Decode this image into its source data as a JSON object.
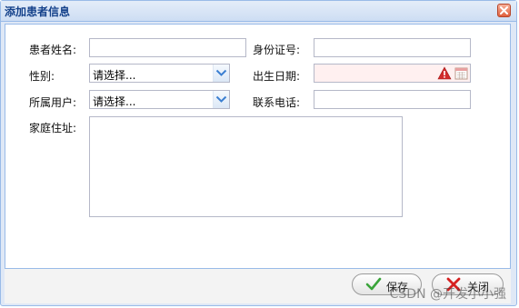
{
  "dialog": {
    "title": "添加患者信息",
    "close_icon": "close-icon"
  },
  "form": {
    "patient_name": {
      "label": "患者姓名:",
      "value": ""
    },
    "id_number": {
      "label": "身份证号:",
      "value": ""
    },
    "gender": {
      "label": "性别:",
      "selected": "请选择..."
    },
    "birth_date": {
      "label": "出生日期:",
      "value": "",
      "status": "invalid",
      "status_icon": "warning-icon",
      "picker_icon": "calendar-icon"
    },
    "owner_user": {
      "label": "所属用户:",
      "selected": "请选择..."
    },
    "phone": {
      "label": "联系电话:",
      "value": ""
    },
    "address": {
      "label": "家庭住址:",
      "value": ""
    }
  },
  "buttons": {
    "save_label": "保存",
    "save_icon": "checkmark-icon",
    "close_label": "关闭",
    "close_icon": "cross-icon"
  },
  "watermark": "CSDN @开发小小强",
  "colors": {
    "title_text": "#15428b",
    "border": "#99bbe8",
    "invalid_bg": "#fff0f0",
    "warning_red": "#d22b2b"
  }
}
